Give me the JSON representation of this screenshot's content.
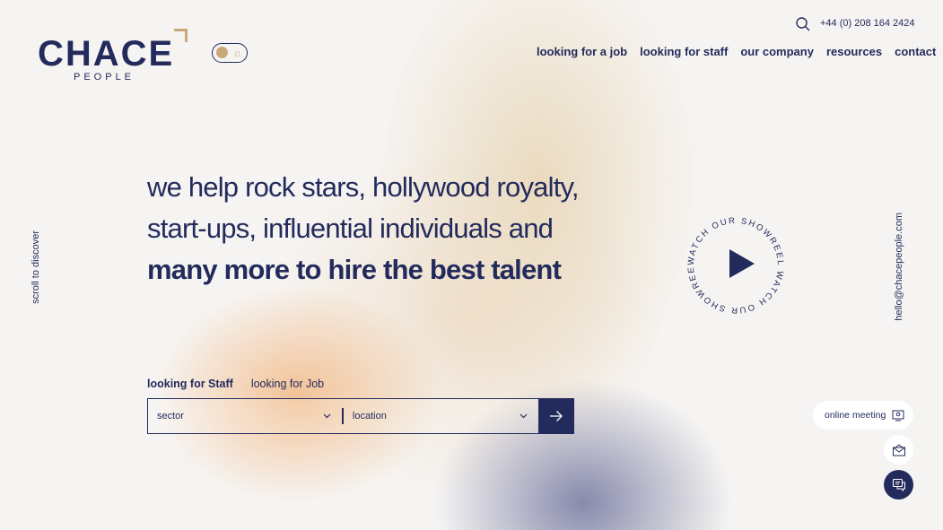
{
  "brand": {
    "name": "CHACE",
    "sub": "PEOPLE",
    "accent_color": "#c9a877",
    "primary_color": "#232b5c"
  },
  "header": {
    "phone": "+44 (0) 208 164 2424",
    "search_icon": "search-icon",
    "nav": [
      {
        "label": "looking for a job"
      },
      {
        "label": "looking for staff"
      },
      {
        "label": "our company"
      },
      {
        "label": "resources"
      },
      {
        "label": "contact"
      }
    ]
  },
  "theme_toggle": {
    "icon": "sun-icon",
    "glyph": "☼"
  },
  "side": {
    "scroll_hint": "scroll to discover",
    "email": "hello@chacepeople.com"
  },
  "hero": {
    "line1": "we help rock stars, hollywood royalty,",
    "line2": "start-ups, influential individuals and",
    "line3": "many more to hire the best talent"
  },
  "showreel": {
    "ring_text": "WATCH OUR SHOWREEL WATCH OUR SHOWREEL ",
    "icon": "play-icon"
  },
  "search": {
    "tabs": [
      {
        "label": "looking for Staff",
        "active": true
      },
      {
        "label": "looking for Job",
        "active": false
      }
    ],
    "sector_placeholder": "sector",
    "location_placeholder": "location",
    "submit_icon": "arrow-right-icon"
  },
  "widgets": {
    "online_meeting_label": "online meeting",
    "online_meeting_icon": "video-icon",
    "mail_icon": "mail-icon",
    "chat_icon": "chat-icon"
  }
}
